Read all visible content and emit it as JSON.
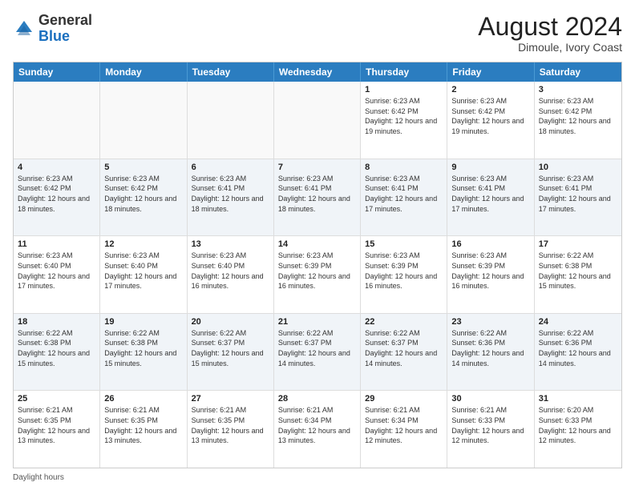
{
  "header": {
    "logo_general": "General",
    "logo_blue": "Blue",
    "month_year": "August 2024",
    "location": "Dimoule, Ivory Coast"
  },
  "footer": {
    "daylight_hours": "Daylight hours"
  },
  "days_of_week": [
    "Sunday",
    "Monday",
    "Tuesday",
    "Wednesday",
    "Thursday",
    "Friday",
    "Saturday"
  ],
  "weeks": [
    [
      {
        "day": "",
        "info": "",
        "empty": true
      },
      {
        "day": "",
        "info": "",
        "empty": true
      },
      {
        "day": "",
        "info": "",
        "empty": true
      },
      {
        "day": "",
        "info": "",
        "empty": true
      },
      {
        "day": "1",
        "info": "Sunrise: 6:23 AM\nSunset: 6:42 PM\nDaylight: 12 hours\nand 19 minutes."
      },
      {
        "day": "2",
        "info": "Sunrise: 6:23 AM\nSunset: 6:42 PM\nDaylight: 12 hours\nand 19 minutes."
      },
      {
        "day": "3",
        "info": "Sunrise: 6:23 AM\nSunset: 6:42 PM\nDaylight: 12 hours\nand 18 minutes."
      }
    ],
    [
      {
        "day": "4",
        "info": "Sunrise: 6:23 AM\nSunset: 6:42 PM\nDaylight: 12 hours\nand 18 minutes."
      },
      {
        "day": "5",
        "info": "Sunrise: 6:23 AM\nSunset: 6:42 PM\nDaylight: 12 hours\nand 18 minutes."
      },
      {
        "day": "6",
        "info": "Sunrise: 6:23 AM\nSunset: 6:41 PM\nDaylight: 12 hours\nand 18 minutes."
      },
      {
        "day": "7",
        "info": "Sunrise: 6:23 AM\nSunset: 6:41 PM\nDaylight: 12 hours\nand 18 minutes."
      },
      {
        "day": "8",
        "info": "Sunrise: 6:23 AM\nSunset: 6:41 PM\nDaylight: 12 hours\nand 17 minutes."
      },
      {
        "day": "9",
        "info": "Sunrise: 6:23 AM\nSunset: 6:41 PM\nDaylight: 12 hours\nand 17 minutes."
      },
      {
        "day": "10",
        "info": "Sunrise: 6:23 AM\nSunset: 6:41 PM\nDaylight: 12 hours\nand 17 minutes."
      }
    ],
    [
      {
        "day": "11",
        "info": "Sunrise: 6:23 AM\nSunset: 6:40 PM\nDaylight: 12 hours\nand 17 minutes."
      },
      {
        "day": "12",
        "info": "Sunrise: 6:23 AM\nSunset: 6:40 PM\nDaylight: 12 hours\nand 17 minutes."
      },
      {
        "day": "13",
        "info": "Sunrise: 6:23 AM\nSunset: 6:40 PM\nDaylight: 12 hours\nand 16 minutes."
      },
      {
        "day": "14",
        "info": "Sunrise: 6:23 AM\nSunset: 6:39 PM\nDaylight: 12 hours\nand 16 minutes."
      },
      {
        "day": "15",
        "info": "Sunrise: 6:23 AM\nSunset: 6:39 PM\nDaylight: 12 hours\nand 16 minutes."
      },
      {
        "day": "16",
        "info": "Sunrise: 6:23 AM\nSunset: 6:39 PM\nDaylight: 12 hours\nand 16 minutes."
      },
      {
        "day": "17",
        "info": "Sunrise: 6:22 AM\nSunset: 6:38 PM\nDaylight: 12 hours\nand 15 minutes."
      }
    ],
    [
      {
        "day": "18",
        "info": "Sunrise: 6:22 AM\nSunset: 6:38 PM\nDaylight: 12 hours\nand 15 minutes."
      },
      {
        "day": "19",
        "info": "Sunrise: 6:22 AM\nSunset: 6:38 PM\nDaylight: 12 hours\nand 15 minutes."
      },
      {
        "day": "20",
        "info": "Sunrise: 6:22 AM\nSunset: 6:37 PM\nDaylight: 12 hours\nand 15 minutes."
      },
      {
        "day": "21",
        "info": "Sunrise: 6:22 AM\nSunset: 6:37 PM\nDaylight: 12 hours\nand 14 minutes."
      },
      {
        "day": "22",
        "info": "Sunrise: 6:22 AM\nSunset: 6:37 PM\nDaylight: 12 hours\nand 14 minutes."
      },
      {
        "day": "23",
        "info": "Sunrise: 6:22 AM\nSunset: 6:36 PM\nDaylight: 12 hours\nand 14 minutes."
      },
      {
        "day": "24",
        "info": "Sunrise: 6:22 AM\nSunset: 6:36 PM\nDaylight: 12 hours\nand 14 minutes."
      }
    ],
    [
      {
        "day": "25",
        "info": "Sunrise: 6:21 AM\nSunset: 6:35 PM\nDaylight: 12 hours\nand 13 minutes."
      },
      {
        "day": "26",
        "info": "Sunrise: 6:21 AM\nSunset: 6:35 PM\nDaylight: 12 hours\nand 13 minutes."
      },
      {
        "day": "27",
        "info": "Sunrise: 6:21 AM\nSunset: 6:35 PM\nDaylight: 12 hours\nand 13 minutes."
      },
      {
        "day": "28",
        "info": "Sunrise: 6:21 AM\nSunset: 6:34 PM\nDaylight: 12 hours\nand 13 minutes."
      },
      {
        "day": "29",
        "info": "Sunrise: 6:21 AM\nSunset: 6:34 PM\nDaylight: 12 hours\nand 12 minutes."
      },
      {
        "day": "30",
        "info": "Sunrise: 6:21 AM\nSunset: 6:33 PM\nDaylight: 12 hours\nand 12 minutes."
      },
      {
        "day": "31",
        "info": "Sunrise: 6:20 AM\nSunset: 6:33 PM\nDaylight: 12 hours\nand 12 minutes."
      }
    ]
  ]
}
